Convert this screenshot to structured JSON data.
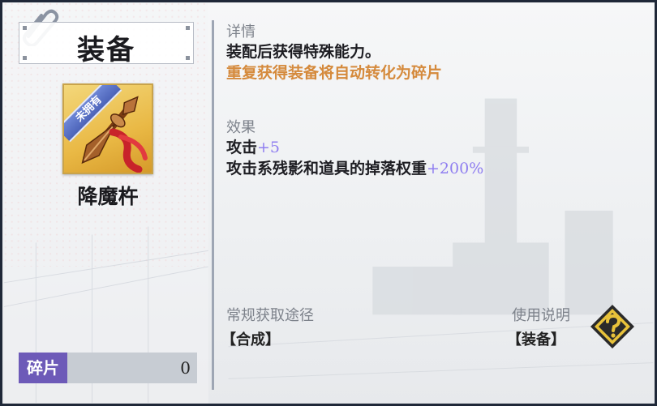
{
  "header": {
    "title": "装备"
  },
  "item": {
    "name": "降魔杵",
    "badge": "未拥有"
  },
  "shard": {
    "label": "碎片",
    "count": "0"
  },
  "details": {
    "label": "详情",
    "desc": "装配后获得特殊能力。",
    "note": "重复获得装备将自动转化为碎片"
  },
  "effects": {
    "label": "效果",
    "line1_prefix": "攻击",
    "line1_value": "+5",
    "line2_prefix": "攻击系残影和道具的掉落权重",
    "line2_value": "+200%"
  },
  "acquire": {
    "label": "常规获取途径",
    "value": "【合成】"
  },
  "usage": {
    "label": "使用说明",
    "value": "【装备】"
  },
  "colors": {
    "accent_orange": "#d58a3c",
    "accent_purple": "#8f7ef0",
    "shard_purple": "#6d5ab8",
    "card_gold": "#e9b844"
  },
  "icons": {
    "clip": "paperclip-icon",
    "help": "question-mark-icon",
    "item": "vajra-weapon-icon"
  }
}
